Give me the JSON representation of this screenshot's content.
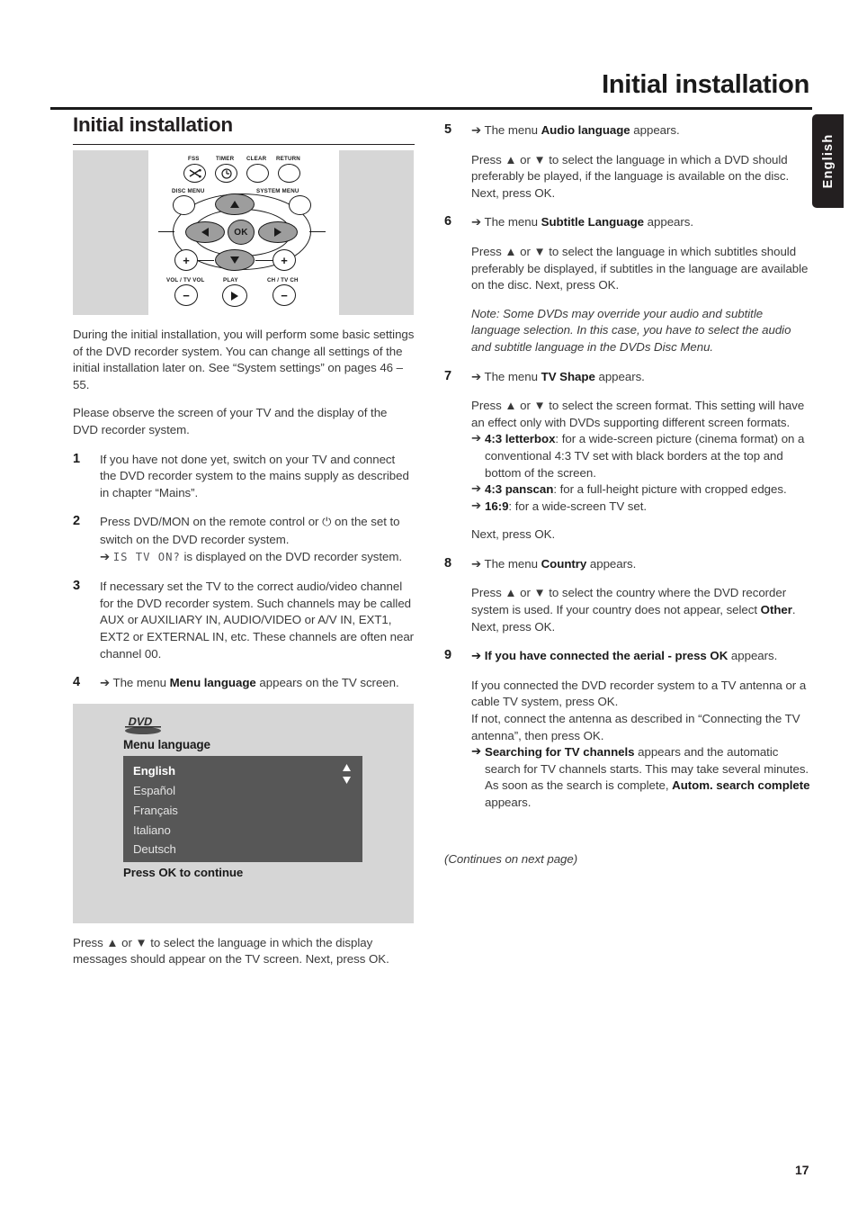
{
  "running_head": "Initial installation",
  "side_tab": {
    "label": "English"
  },
  "folio": "17",
  "left": {
    "section_title": "Initial installation",
    "remote_figure": {
      "name": "remote-control-keypad",
      "labels": {
        "fss": "FSS",
        "timer": "TIMER",
        "clear": "CLEAR",
        "return": "RETURN",
        "disc_menu": "DISC MENU",
        "system_menu": "SYSTEM MENU",
        "vol": "VOL / TV VOL",
        "play": "PLAY",
        "ch": "CH / TV CH",
        "ok": "OK",
        "plus": "+",
        "minus": "−"
      }
    },
    "intro_1": "During the initial installation, you will perform some basic settings of the DVD recorder system. You can change all settings of the initial installation later on. See “System settings” on pages 46 – 55.",
    "intro_2": "Please observe the screen of your TV and the display of the DVD recorder system.",
    "steps": [
      {
        "num": "1",
        "paragraphs": [
          "If you have not done yet, switch on your TV and connect the DVD recorder system to the mains supply as described in chapter “Mains”."
        ]
      },
      {
        "num": "2",
        "line_1": "Press DVD/MON on the remote control or ",
        "line_1b": " on the set to switch on the DVD recorder system.",
        "arrow": "➔",
        "lcd": "IS TV ON?",
        "line_2": " is displayed on the DVD recorder system."
      },
      {
        "num": "3",
        "paragraphs": [
          "If necessary set the TV to the correct audio/video channel for the DVD recorder system. Such channels may be called AUX or AUXILIARY IN, AUDIO/VIDEO or A/V IN, EXT1, EXT2 or EXTERNAL IN, etc. These channels are often near channel 00."
        ]
      },
      {
        "num": "4",
        "arrow": "➔",
        "pre": "The menu ",
        "bold": "Menu language",
        "post": " appears on the TV screen."
      }
    ],
    "tv_figure": {
      "logo": "DVD",
      "menu_title": "Menu language",
      "items": [
        "English",
        "Español",
        "Français",
        "Italiano",
        "Deutsch"
      ],
      "selected_index": 0,
      "footer": "Press OK to continue"
    },
    "closing": "Press ▲ or ▼ to select the language in which the display messages should appear on the TV screen. Next, press OK."
  },
  "right": {
    "steps": [
      {
        "num": "5",
        "arrow": "➔",
        "lead_pre": "The menu ",
        "lead_bold": "Audio language",
        "lead_post": " appears.",
        "body": "Press ▲ or ▼ to select the language in which a DVD should preferably be played, if the language is available on the disc. Next, press OK."
      },
      {
        "num": "6",
        "arrow": "➔",
        "lead_pre": "The menu ",
        "lead_bold": "Subtitle Language",
        "lead_post": " appears.",
        "body": "Press ▲ or ▼ to select the language in which subtitles should preferably be displayed, if subtitles in the language are available on the disc. Next, press OK.",
        "note": "Note: Some DVDs may override your audio and subtitle language selection. In this case, you have to select the audio and subtitle language in the DVDs Disc Menu."
      },
      {
        "num": "7",
        "arrow": "➔",
        "lead_pre": "The menu ",
        "lead_bold": "TV Shape",
        "lead_post": " appears.",
        "body": "Press ▲ or ▼ to select the screen format. This setting will have an effect only with DVDs supporting different screen formats.",
        "options": [
          {
            "arrow": "➔",
            "bold": "4:3 letterbox",
            "text": ": for a wide-screen picture (cinema format) on a conventional 4:3 TV set with black borders at the top and bottom of the screen."
          },
          {
            "arrow": "➔",
            "bold": "4:3 panscan",
            "text": ": for a full-height picture with cropped edges."
          },
          {
            "arrow": "➔",
            "bold": "16:9",
            "text": ": for a wide-screen TV set."
          }
        ],
        "tail": "Next, press OK."
      },
      {
        "num": "8",
        "arrow": "➔",
        "lead_pre": "The menu ",
        "lead_bold": "Country",
        "lead_post": " appears.",
        "body_pre": "Press ▲ or ▼ to select the  country where the DVD recorder system is used. If your country does not appear, select ",
        "body_bold": "Other",
        "body_post": ". Next, press OK."
      },
      {
        "num": "9",
        "arrow": "➔",
        "lead_bold": "If you have connected the aerial - press OK",
        "lead_post": " appears.",
        "body": "If you connected the DVD recorder system to a TV antenna or a cable TV system, press OK.\nIf not, connect the antenna as described in “Connecting the TV antenna”, then press OK.",
        "result": {
          "arrow": "➔",
          "bold_1": "Searching for TV channels",
          "mid": " appears and the automatic search for TV channels starts. This may take several minutes. As soon as the search is complete, ",
          "bold_2": "Autom. search complete",
          "tail": " appears."
        }
      }
    ],
    "continues": "(Continues on next page)"
  },
  "colors": {
    "figure_bg": "#d6d6d6",
    "listbox_bg": "#575757",
    "tab_bg": "#231f20",
    "text": "#3a3a3a"
  }
}
